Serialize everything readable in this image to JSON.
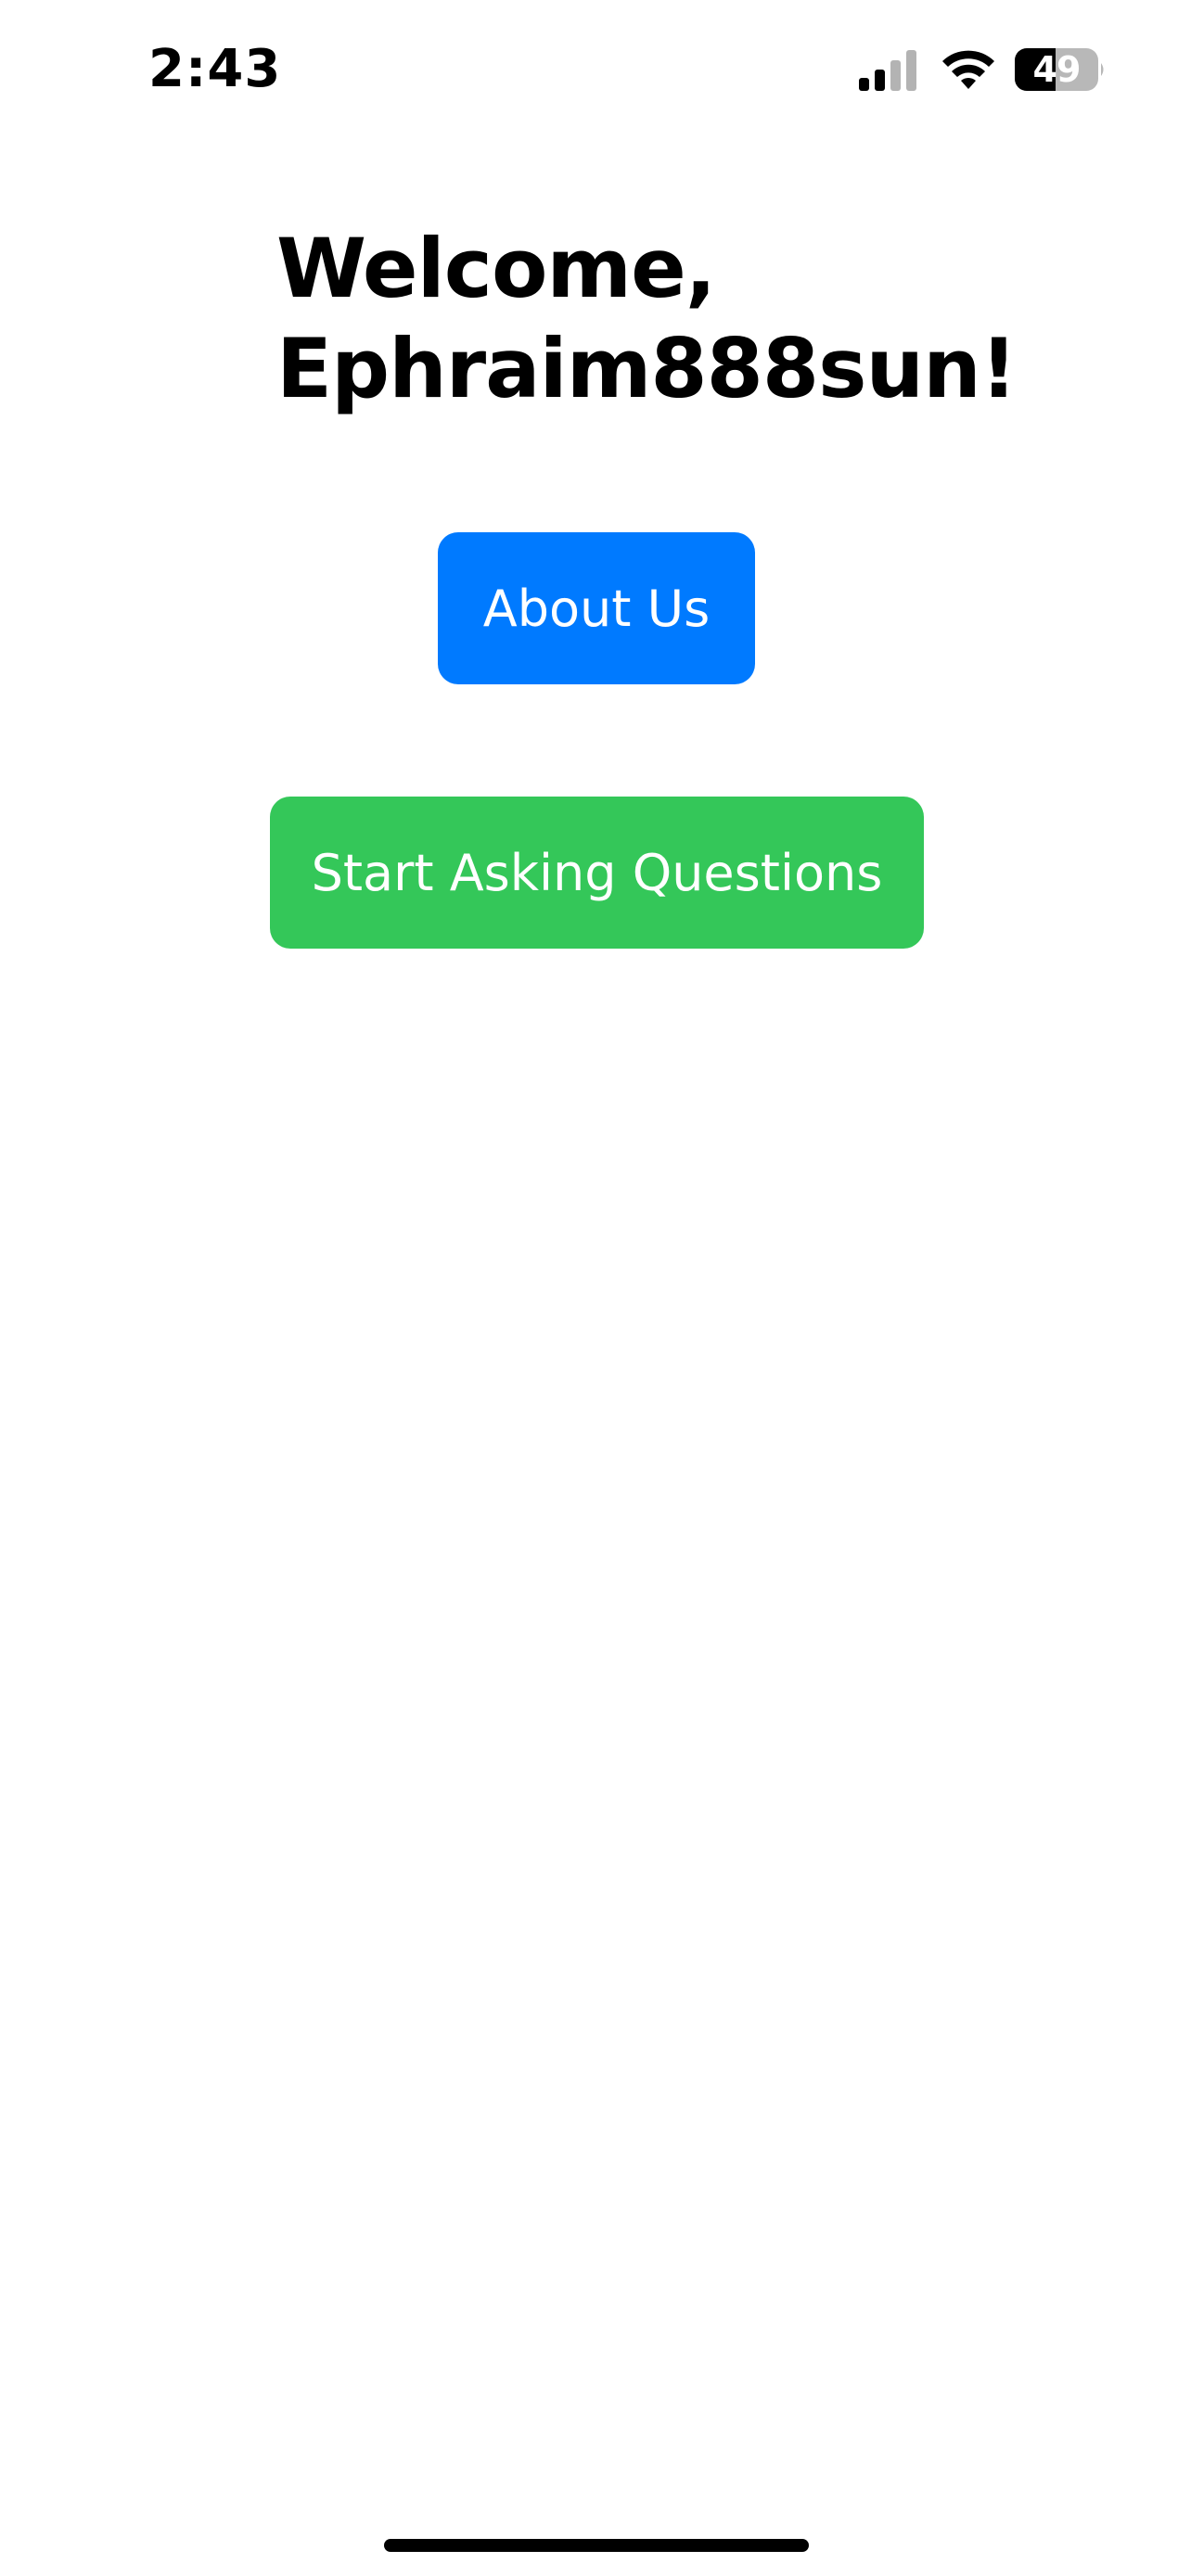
{
  "status_bar": {
    "time": "2:43",
    "battery_level": "49",
    "icons": [
      "signal-icon",
      "wifi-icon",
      "battery-icon"
    ]
  },
  "welcome": {
    "line1": "Welcome,",
    "line2": "Ephraim888sun!"
  },
  "buttons": {
    "about_label": "About Us",
    "start_label": "Start Asking Questions"
  },
  "colors": {
    "about_button": "#007aff",
    "start_button": "#34c759",
    "background": "#ffffff",
    "text": "#000000"
  }
}
